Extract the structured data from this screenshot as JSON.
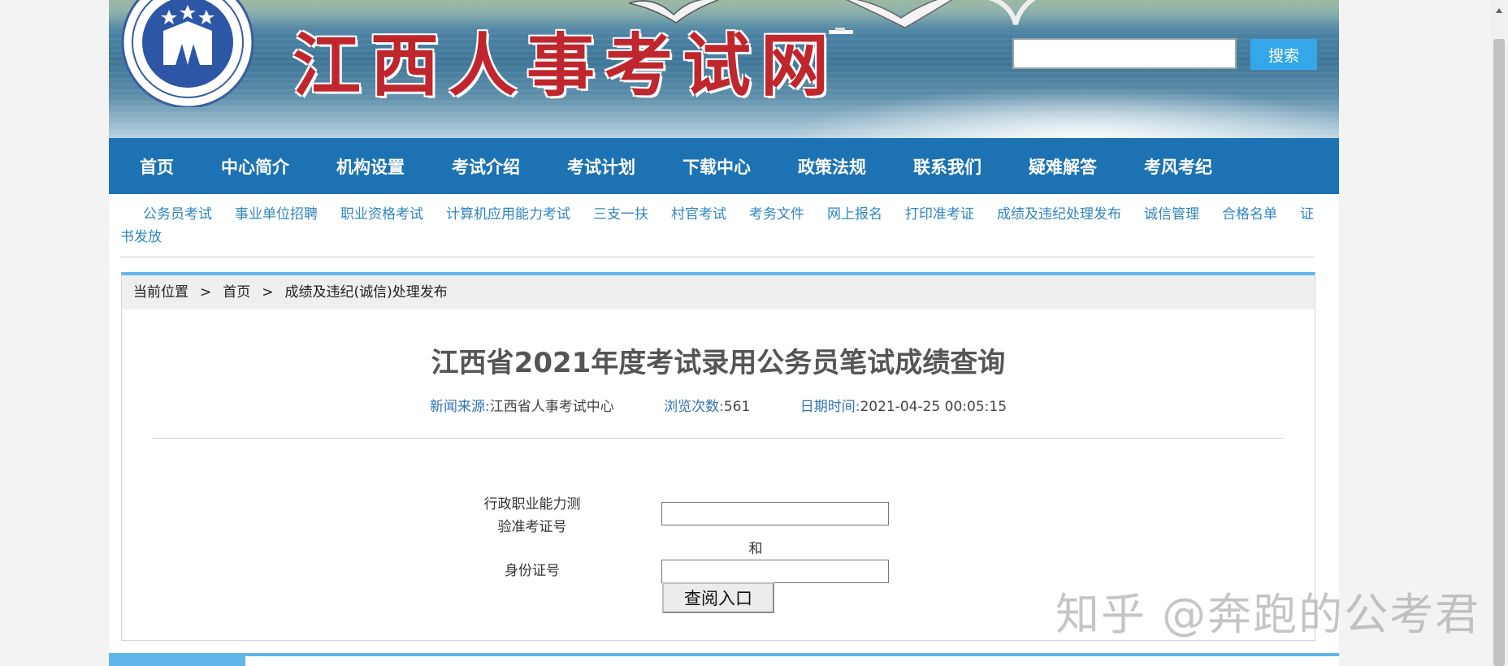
{
  "header": {
    "site_title": "江西人事考试网",
    "search_placeholder": "",
    "search_button": "搜索",
    "logo_icon": "jiangxi-personnel-testing-center-logo"
  },
  "main_nav": [
    {
      "label": "首页"
    },
    {
      "label": "中心简介"
    },
    {
      "label": "机构设置"
    },
    {
      "label": "考试介绍"
    },
    {
      "label": "考试计划"
    },
    {
      "label": "下载中心"
    },
    {
      "label": "政策法规"
    },
    {
      "label": "联系我们"
    },
    {
      "label": "疑难解答"
    },
    {
      "label": "考风考纪"
    }
  ],
  "sub_nav": [
    {
      "label": "公务员考试"
    },
    {
      "label": "事业单位招聘"
    },
    {
      "label": "职业资格考试"
    },
    {
      "label": "计算机应用能力考试"
    },
    {
      "label": "三支一扶"
    },
    {
      "label": "村官考试"
    },
    {
      "label": "考务文件"
    },
    {
      "label": "网上报名"
    },
    {
      "label": "打印准考证"
    },
    {
      "label": "成绩及违纪处理发布"
    },
    {
      "label": "诚信管理"
    },
    {
      "label": "合格名单"
    },
    {
      "label": "证书发放"
    }
  ],
  "breadcrumb": {
    "prefix": "当前位置",
    "separator": ">",
    "items": [
      "首页",
      "成绩及违纪(诚信)处理发布"
    ]
  },
  "article": {
    "title": "江西省2021年度考试录用公务员笔试成绩查询",
    "source_label": "新闻来源:",
    "source_value": "江西省人事考试中心",
    "views_label": "浏览次数:",
    "views_value": "561",
    "date_label": "日期时间:",
    "date_value": "2021-04-25 00:05:15"
  },
  "form": {
    "exam_number_label_line1": "行政职业能力测",
    "exam_number_label_line2": "验准考证号",
    "exam_number_value": "",
    "and_text": "和",
    "id_number_label": "身份证号",
    "id_number_value": "",
    "submit_button": "查阅入口"
  },
  "watermark": "知乎 @奔跑的公考君",
  "colors": {
    "nav_background": "#1c72b2",
    "link_blue": "#2f86bf",
    "accent_blue": "#5fb6ea",
    "search_button": "#33a7ea",
    "title_red": "#c0262d"
  }
}
